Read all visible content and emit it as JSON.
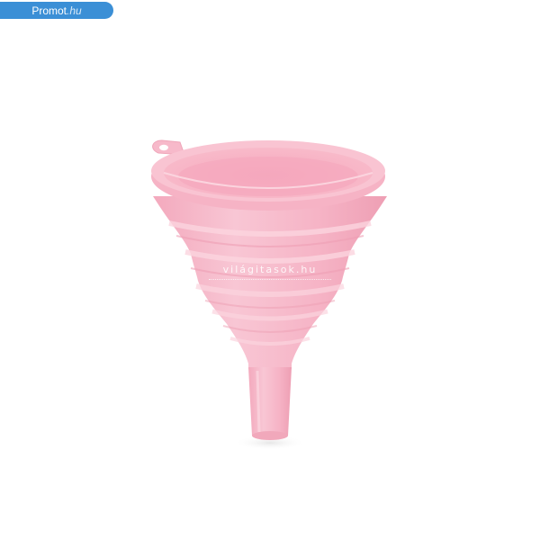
{
  "badge": {
    "brand": "Promot",
    "tld": ".hu",
    "color": "#3b8fd6"
  },
  "watermark": {
    "text": "világitasok.hu"
  },
  "product": {
    "icon": "funnel-icon",
    "color": "#f5b6c8"
  }
}
